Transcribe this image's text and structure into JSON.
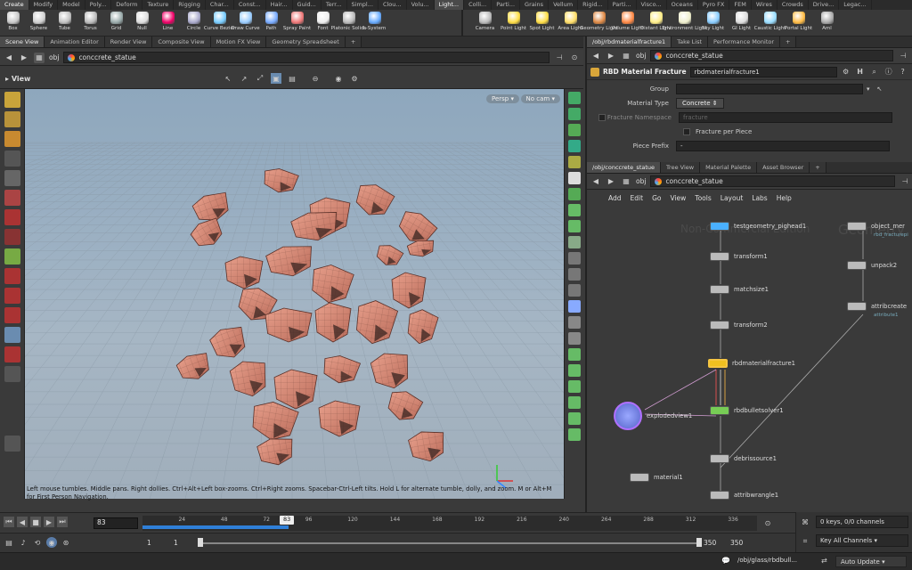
{
  "shelf_tabs": [
    "Create",
    "Modify",
    "Model",
    "Poly...",
    "Deform",
    "Texture",
    "Rigging",
    "Char...",
    "Const...",
    "Hair...",
    "Guid...",
    "Terr...",
    "Simpl...",
    "Clou...",
    "Volu...",
    "Light...",
    "Colli...",
    "Parti...",
    "Grains",
    "Vellum",
    "Rigid...",
    "Parti...",
    "Visco...",
    "Oceans",
    "Pyro FX",
    "FEM",
    "Wires",
    "Crowds",
    "Drive...",
    "Legac..."
  ],
  "shelf_left_tools": [
    {
      "label": "Box",
      "color": "#c8c8c8"
    },
    {
      "label": "Sphere",
      "color": "#d0d0d0"
    },
    {
      "label": "Tube",
      "color": "#c0c0c0"
    },
    {
      "label": "Torus",
      "color": "#bbbbbb"
    },
    {
      "label": "Grid",
      "color": "#9aa"
    },
    {
      "label": "Null",
      "color": "#ddd"
    },
    {
      "label": "Line",
      "color": "#e06"
    },
    {
      "label": "Circle",
      "color": "#aac"
    },
    {
      "label": "Curve Bezier",
      "color": "#7cf"
    },
    {
      "label": "Draw Curve",
      "color": "#9cf"
    },
    {
      "label": "Path",
      "color": "#7af"
    },
    {
      "label": "Spray Paint",
      "color": "#e77"
    },
    {
      "label": "Font",
      "color": "#eee"
    },
    {
      "label": "Platonic Solids",
      "color": "#bbb"
    },
    {
      "label": "L-System",
      "color": "#6af"
    }
  ],
  "shelf_right_tools": [
    {
      "label": "Camera",
      "color": "#bbb"
    },
    {
      "label": "Point Light",
      "color": "#fd4"
    },
    {
      "label": "Spot Light",
      "color": "#fd4"
    },
    {
      "label": "Area Light",
      "color": "#fd6"
    },
    {
      "label": "Geometry Light",
      "color": "#d84"
    },
    {
      "label": "Volume Light",
      "color": "#f84"
    },
    {
      "label": "Distant Light",
      "color": "#fe8"
    },
    {
      "label": "Environment Light",
      "color": "#eec"
    },
    {
      "label": "Sky Light",
      "color": "#8cf"
    },
    {
      "label": "GI Light",
      "color": "#ddd"
    },
    {
      "label": "Caustic Light",
      "color": "#9df"
    },
    {
      "label": "Portal Light",
      "color": "#fb4"
    },
    {
      "label": "Aml",
      "color": "#aaa"
    }
  ],
  "left_panel": {
    "tabs": [
      "Scene View",
      "Animation Editor",
      "Render View",
      "Composite View",
      "Motion FX View",
      "Geometry Spreadsheet"
    ],
    "path": "conccrete_statue",
    "path_prefix": "obj",
    "view_label": "View",
    "persp": "Persp",
    "cam": "No cam",
    "status_message": "Left mouse tumbles. Middle pans. Right dollies. Ctrl+Alt+Left box-zooms. Ctrl+Right zooms. Spacebar-Ctrl-Left tilts. Hold L for alternate tumble, dolly, and zoom.    M or Alt+M for First Person Navigation."
  },
  "right_top": {
    "tabs": [
      "/obj/rbdmaterialfracture1",
      "Take List",
      "Performance Monitor"
    ],
    "path_prefix": "obj",
    "path": "conccrete_statue",
    "node_type": "RBD Material Fracture",
    "node_name": "rbdmaterialfracture1",
    "parms": {
      "group_label": "Group",
      "group_value": "",
      "material_type_label": "Material Type",
      "material_type_value": "Concrete",
      "fracture_ns_label": "Fracture Namespace",
      "fracture_ns_value": "fracture",
      "fracture_per_piece": "Fracture per Piece",
      "piece_prefix_label": "Piece Prefix",
      "piece_prefix_value": "-"
    }
  },
  "right_bottom": {
    "tabs": [
      "/obj/conccrete_statue",
      "Tree View",
      "Material Palette",
      "Asset Browser"
    ],
    "path_prefix": "obj",
    "path": "conccrete_statue",
    "menu": [
      "Add",
      "Edit",
      "Go",
      "View",
      "Tools",
      "Layout",
      "Labs",
      "Help"
    ],
    "watermark_1": "Non-Commercial Edition",
    "watermark_2": "Geometry",
    "nodes": {
      "n1": "testgeometry_pighead1",
      "n2": "transform1",
      "n3": "matchsize1",
      "n4": "transform2",
      "n5": "rbdmaterialfracture1",
      "n6": "rbdbulletsolver1",
      "n7": "debrissource1",
      "n8": "attribwrangle1",
      "n9": "explodedview1",
      "n10": "material1",
      "n11": "object_mer",
      "n12": "unpack2",
      "n13": "attribcreate",
      "n11_sub": "rbd_fracturepi",
      "n13_sub": "attribute1"
    }
  },
  "timeline": {
    "ticks": [
      "24",
      "48",
      "72",
      "96",
      "120",
      "144",
      "168",
      "192",
      "216",
      "240",
      "264",
      "288",
      "312",
      "336"
    ],
    "current_frame": "83",
    "frame_field": "83",
    "start": "1",
    "start2": "1",
    "end": "350",
    "end2": "350",
    "playback_progress": 0.237
  },
  "keys": {
    "count": "0 keys, 0/0 channels",
    "channels": "Key All Channels"
  },
  "status": {
    "path": "/obj/glass/rbdbull...",
    "update": "Auto Update"
  },
  "colors": {
    "accent": "#f5a623",
    "selected_node": "#f0c020",
    "display_node": "#4ab0ff",
    "render_node": "#b070ff"
  }
}
